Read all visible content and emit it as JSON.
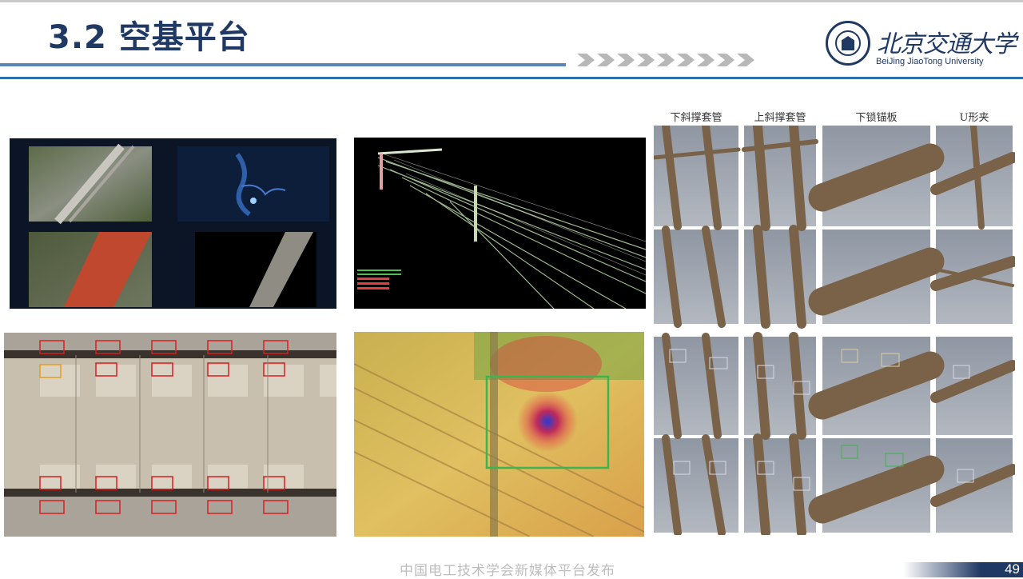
{
  "title": "3.2 空基平台",
  "logo": {
    "cn": "北京交通大学",
    "en": "BeiJing JiaoTong University"
  },
  "component_headers": [
    "下斜撑套管",
    "上斜撑套管",
    "下锁锚板",
    "U形夹"
  ],
  "footer": "中国电工技术学会新媒体平台发布",
  "page_number": "49",
  "colors": {
    "title": "#1f3864",
    "rule": "#2e6fb0",
    "accent": "#5b87b8"
  },
  "icons": [
    "university-seal-icon",
    "chevron-arrows-icon"
  ]
}
